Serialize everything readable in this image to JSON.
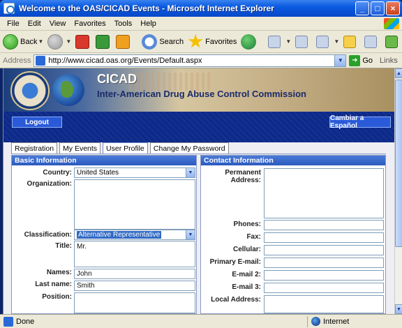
{
  "window": {
    "title": "Welcome to the OAS/CICAD Events - Microsoft Internet Explorer"
  },
  "menu": [
    "File",
    "Edit",
    "View",
    "Favorites",
    "Tools",
    "Help"
  ],
  "toolbar": {
    "back": "Back",
    "search": "Search",
    "favorites": "Favorites"
  },
  "address": {
    "label": "Address",
    "url": "http://www.cicad.oas.org/Events/Default.aspx",
    "go": "Go",
    "links": "Links"
  },
  "banner": {
    "acronym": "CICAD",
    "fullname": "Inter-American Drug Abuse Control Commission"
  },
  "nav": {
    "logout": "Logout",
    "language": "Cambiar a Español"
  },
  "tabs": [
    {
      "label": "Registration"
    },
    {
      "label": "My Events"
    },
    {
      "label": "User Profile"
    },
    {
      "label": "Change My Password"
    }
  ],
  "basic": {
    "header": "Basic Information",
    "country_label": "Country:",
    "country_value": "United States",
    "organization_label": "Organization:",
    "organization_value": "",
    "classification_label": "Classification:",
    "classification_value": "Alternative Representative",
    "title_label": "Title:",
    "title_value": "Mr.",
    "names_label": "Names:",
    "names_value": "John",
    "lastname_label": "Last name:",
    "lastname_value": "Smith",
    "position_label": "Position:",
    "position_value": ""
  },
  "contact": {
    "header": "Contact Information",
    "permanent_label": "Permanent",
    "permanent_label2": "Address:",
    "phones_label": "Phones:",
    "fax_label": "Fax:",
    "cellular_label": "Cellular:",
    "primary_email_label": "Primary E-mail:",
    "email2_label": "E-mail 2:",
    "email3_label": "E-mail 3:",
    "local_address_label": "Local Address:"
  },
  "status": {
    "text": "Done",
    "zone": "Internet"
  }
}
